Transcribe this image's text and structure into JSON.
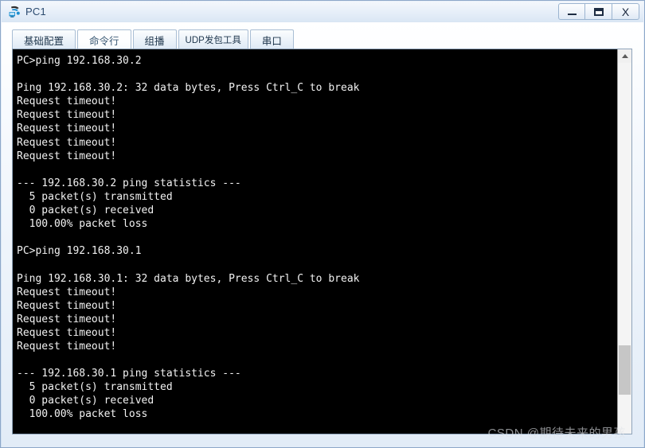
{
  "window": {
    "title": "PC1",
    "icon": "pc-device-icon",
    "buttons": {
      "minimize": "–",
      "maximize": "□",
      "close": "X"
    }
  },
  "tabs": [
    {
      "id": "tab-basic-config",
      "label": "基础配置",
      "selected": false
    },
    {
      "id": "tab-command-line",
      "label": "命令行",
      "selected": true
    },
    {
      "id": "tab-multicast",
      "label": "组播",
      "selected": false
    },
    {
      "id": "tab-udp-packet-tool",
      "label": "UDP发包工具",
      "selected": false
    },
    {
      "id": "tab-serial-port",
      "label": "串口",
      "selected": false
    }
  ],
  "console": {
    "text": "PC>ping 192.168.30.2\n\nPing 192.168.30.2: 32 data bytes, Press Ctrl_C to break\nRequest timeout!\nRequest timeout!\nRequest timeout!\nRequest timeout!\nRequest timeout!\n\n--- 192.168.30.2 ping statistics ---\n  5 packet(s) transmitted\n  0 packet(s) received\n  100.00% packet loss\n\nPC>ping 192.168.30.1\n\nPing 192.168.30.1: 32 data bytes, Press Ctrl_C to break\nRequest timeout!\nRequest timeout!\nRequest timeout!\nRequest timeout!\nRequest timeout!\n\n--- 192.168.30.1 ping statistics ---\n  5 packet(s) transmitted\n  0 packet(s) received\n  100.00% packet loss\n",
    "lines": [
      "PC>ping 192.168.30.2",
      "",
      "Ping 192.168.30.2: 32 data bytes, Press Ctrl_C to break",
      "Request timeout!",
      "Request timeout!",
      "Request timeout!",
      "Request timeout!",
      "Request timeout!",
      "",
      "--- 192.168.30.2 ping statistics ---",
      "  5 packet(s) transmitted",
      "  0 packet(s) received",
      "  100.00% packet loss",
      "",
      "PC>ping 192.168.30.1",
      "",
      "Ping 192.168.30.1: 32 data bytes, Press Ctrl_C to break",
      "Request timeout!",
      "Request timeout!",
      "Request timeout!",
      "Request timeout!",
      "Request timeout!",
      "",
      "--- 192.168.30.1 ping statistics ---",
      "  5 packet(s) transmitted",
      "  0 packet(s) received",
      "  100.00% packet loss"
    ],
    "foreground_color": "#f2f2f2",
    "background_color": "#000000"
  },
  "watermark": {
    "text": "CSDN @期待未来的男孩"
  }
}
